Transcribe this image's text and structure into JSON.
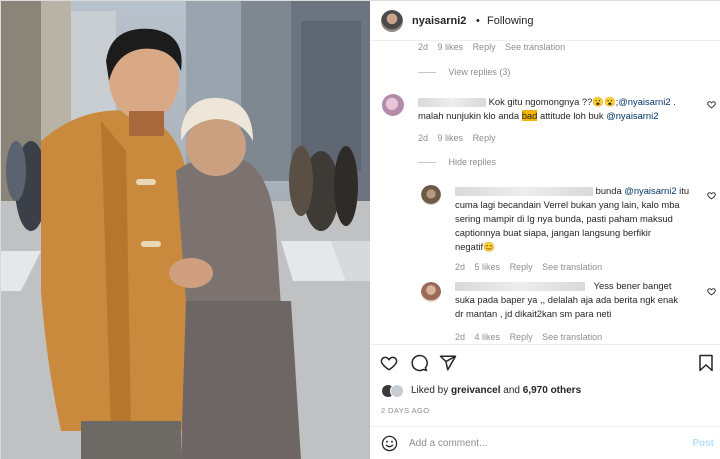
{
  "post": {
    "username": "nyaisarni2",
    "header_separator": "•",
    "follow_status": "Following"
  },
  "comments": {
    "top_meta": {
      "age": "2d",
      "likes": "9 likes",
      "reply": "Reply",
      "translation": "See translation"
    },
    "view_replies": "View replies (3)",
    "comment1": {
      "text_line1_pre": "Kok gitu ngomongnya ??😮😮;",
      "mention1": "@nyaisarni2",
      "text_line1_post": " .",
      "text_line2_pre": "malah nunjukin klo anda ",
      "highlight": "bad",
      "text_line2_post": " attitude loh buk ",
      "mention2": "@nyaisarni2",
      "meta": {
        "age": "2d",
        "likes": "9 likes",
        "reply": "Reply"
      },
      "hide_replies": "Hide replies"
    },
    "reply1": {
      "text_pre": "bunda ",
      "mention": "@nyaisarni2",
      "text_post": " itu",
      "lines": [
        "cuma lagi becandain Verrel bukan yang lain, kalo mba",
        "sering mampir di Ig nya bunda, pasti paham maksud",
        "captionnya buat siapa, jangan langsung berfikir",
        "negatif😊"
      ],
      "meta": {
        "age": "2d",
        "likes": "5 likes",
        "reply": "Reply",
        "translation": "See translation"
      }
    },
    "reply2": {
      "text_first": "Yess bener banget",
      "lines": [
        "suka pada baper ya ,, delalah aja ada berita ngk enak",
        "dr mantan , jd dikait2kan sm para neti"
      ],
      "meta": {
        "age": "2d",
        "likes": "4 likes",
        "reply": "Reply",
        "translation": "See translation"
      }
    }
  },
  "actions": {
    "liked_prefix": "Liked by ",
    "liked_user": "greivancel",
    "liked_and": " and ",
    "liked_count": "6,970 others",
    "date": "2 DAYS AGO"
  },
  "composer": {
    "placeholder": "Add a comment...",
    "post_label": "Post"
  },
  "colors": {
    "link": "#00376b",
    "muted": "#8e8e8e",
    "highlight": "#f4b400",
    "post_disabled": "#b2dffc"
  },
  "icons": [
    "heart-icon",
    "comment-icon",
    "share-icon",
    "bookmark-icon",
    "emoji-icon"
  ]
}
